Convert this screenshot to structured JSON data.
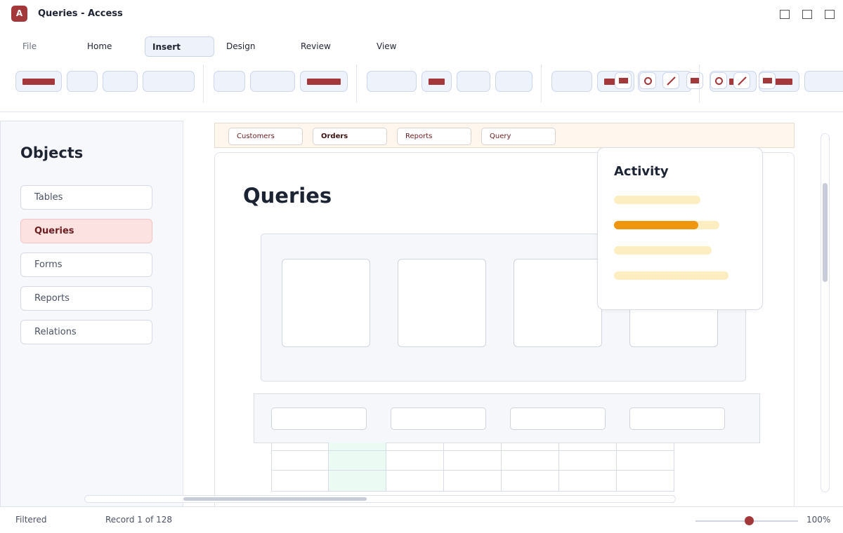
{
  "window": {
    "title": "Queries - Access",
    "app_icon_letter": "A"
  },
  "ribbon": {
    "tabs": [
      {
        "label": "File"
      },
      {
        "label": "Home"
      },
      {
        "label": "Insert"
      },
      {
        "label": "Design"
      },
      {
        "label": "Review"
      },
      {
        "label": "View"
      }
    ],
    "active_tab": "Insert"
  },
  "objects": {
    "title": "Objects",
    "items": [
      {
        "label": "Tables"
      },
      {
        "label": "Queries"
      },
      {
        "label": "Forms"
      },
      {
        "label": "Reports"
      },
      {
        "label": "Relations"
      }
    ],
    "selected": "Queries"
  },
  "document_tabs": [
    {
      "label": "Customers"
    },
    {
      "label": "Orders"
    },
    {
      "label": "Reports"
    },
    {
      "label": "Query"
    }
  ],
  "active_document_tab": "Orders",
  "main": {
    "title": "Queries"
  },
  "activity": {
    "title": "Activity",
    "progress_fraction": 0.8
  },
  "status": {
    "filter": "Filtered",
    "record": "Record 1 of 128",
    "zoom": "100%"
  },
  "colors": {
    "accent": "#a4373a",
    "activity_fill": "#ee960f",
    "activity_track": "#fdeec2",
    "selected_item_bg": "#fde2e2"
  }
}
